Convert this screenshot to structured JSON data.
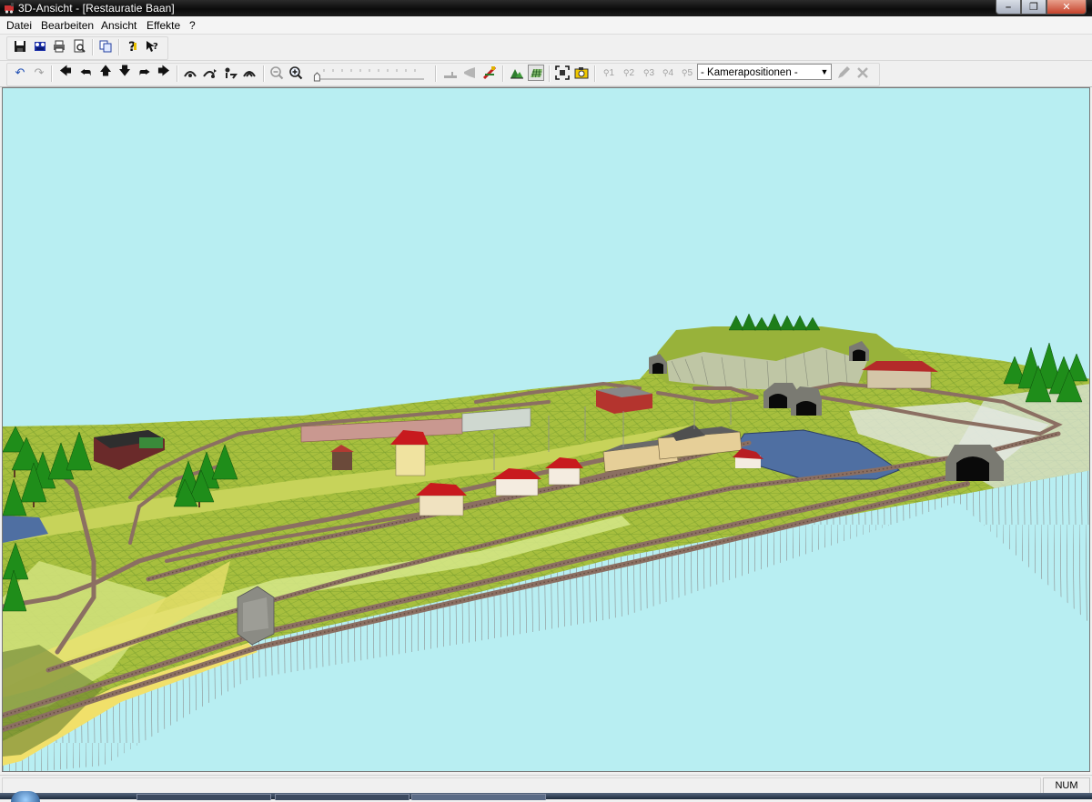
{
  "window": {
    "title": "3D-Ansicht - [Restauratie Baan]"
  },
  "menu": [
    "Datei",
    "Bearbeiten",
    "Ansicht",
    "Effekte",
    "?"
  ],
  "toolbar1": {
    "icons": [
      "save-icon",
      "film-icon",
      "print-icon",
      "print-preview-icon",
      "copy-icon",
      "help-icon",
      "context-help-icon"
    ]
  },
  "toolbar2": {
    "icons": [
      "undo-icon",
      "redo-icon",
      "arrow-left-icon",
      "turn-left-icon",
      "arrow-up-icon",
      "arrow-down-icon",
      "turn-right-icon",
      "arrow-right-icon",
      "walk-up-icon",
      "walk-forward-icon",
      "walk-down-icon",
      "walk-back-icon",
      "zoom-out-icon",
      "zoom-in-icon",
      "ground-icon",
      "horn-icon",
      "signal-icon",
      "landscape-icon",
      "grid-icon",
      "fit-view-icon",
      "camera-icon"
    ],
    "camera_slots": [
      "1",
      "2",
      "3",
      "4",
      "5"
    ],
    "camera_select": {
      "value": "- Kamerapositionen -"
    },
    "zoom_level": 0.02
  },
  "status": {
    "num": "NUM"
  },
  "colors": {
    "sky": "#b8eef2",
    "grass": "#9bb83a",
    "meadow": "#c9d95a",
    "track": "#8a6b5a",
    "wire": "#8f8f8f",
    "roof_red": "#c0161c",
    "water": "#4a6ea0"
  }
}
